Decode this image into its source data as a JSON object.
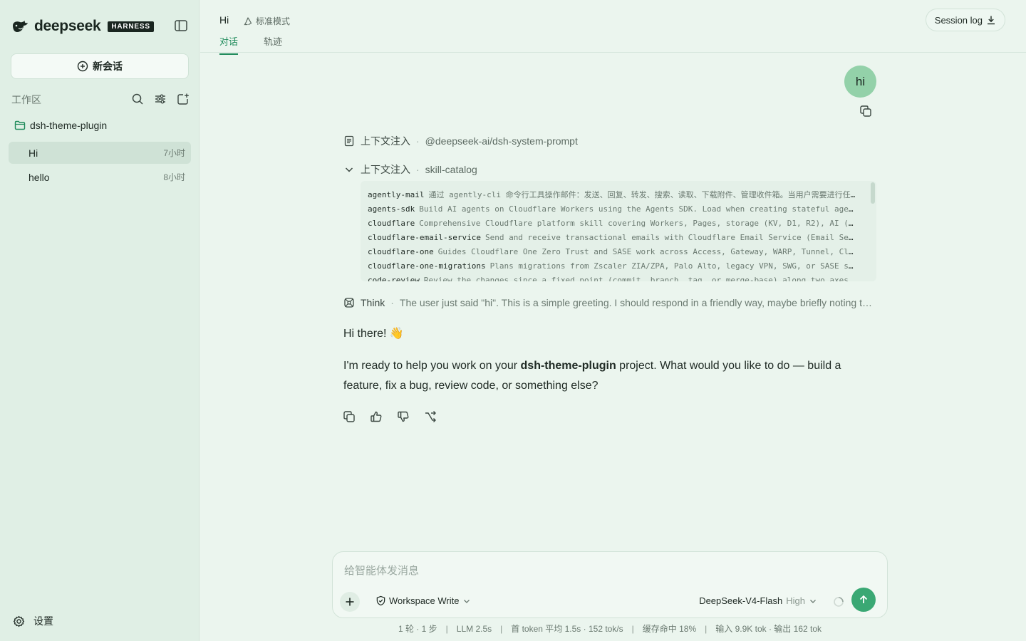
{
  "brand": {
    "name": "deepseek",
    "badge": "HARNESS"
  },
  "sidebar": {
    "new_chat_label": "新会话",
    "workspace_label": "工作区",
    "project": "dsh-theme-plugin",
    "sessions": [
      {
        "title": "Hi",
        "time": "7小时",
        "active": true
      },
      {
        "title": "hello",
        "time": "8小时",
        "active": false
      }
    ],
    "settings_label": "设置"
  },
  "header": {
    "title": "Hi",
    "mode": "标准模式",
    "tabs": [
      {
        "label": "对话",
        "active": true
      },
      {
        "label": "轨迹",
        "active": false
      }
    ],
    "session_log_label": "Session log"
  },
  "conversation": {
    "user_message": "hi",
    "context_injections": [
      {
        "label": "上下文注入",
        "source": "@deepseek-ai/dsh-system-prompt"
      },
      {
        "label": "上下文注入",
        "source": "skill-catalog"
      }
    ],
    "skill_catalog": [
      {
        "name": "agently-mail",
        "desc": "通过 agently-cli 命令行工具操作邮件：发送、回复、转发、搜索、读取、下载附件、管理收件箱。当用户需要进行任何邮件相关操作时使用"
      },
      {
        "name": "agents-sdk",
        "desc": "Build AI agents on Cloudflare Workers using the Agents SDK. Load when creating stateful agents"
      },
      {
        "name": "cloudflare",
        "desc": "Comprehensive Cloudflare platform skill covering Workers, Pages, storage (KV, D1, R2), AI (Workers AI)"
      },
      {
        "name": "cloudflare-email-service",
        "desc": "Send and receive transactional emails with Cloudflare Email Service (Email Sending)"
      },
      {
        "name": "cloudflare-one",
        "desc": "Guides Cloudflare One Zero Trust and SASE work across Access, Gateway, WARP, Tunnel, Cloudflare"
      },
      {
        "name": "cloudflare-one-migrations",
        "desc": "Plans migrations from Zscaler ZIA/ZPA, Palo Alto, legacy VPN, SWG, or SASE solutions"
      },
      {
        "name": "code-review",
        "desc": "Review the changes since a fixed point (commit, branch, tag, or merge-base) along two axes"
      }
    ],
    "think_label": "Think",
    "think_text": "The user just said \"hi\". This is a simple greeting. I should respond in a friendly way, maybe briefly noting the project.",
    "reply_greeting": "Hi there! 👋",
    "reply_before": "I'm ready to help you work on your ",
    "reply_bold": "dsh-theme-plugin",
    "reply_after": " project. What would you like to do — build a feature, fix a bug, review code, or something else?"
  },
  "composer": {
    "placeholder": "给智能体发消息",
    "permission_label": "Workspace Write",
    "model_name": "DeepSeek-V4-Flash",
    "effort": "High"
  },
  "stats": {
    "turns": "1 轮 · 1 步",
    "llm": "LLM 2.5s",
    "first_token": "首 token 平均 1.5s · 152 tok/s",
    "cache": "缓存命中 18%",
    "tokens": "输入 9.9K tok · 输出 162 tok"
  },
  "colors": {
    "accent": "#1e8a5a",
    "send_button": "#3aa874",
    "user_bubble": "#93d1a9",
    "sidebar_bg": "#e0efe5",
    "main_bg": "#ebf5ee"
  }
}
